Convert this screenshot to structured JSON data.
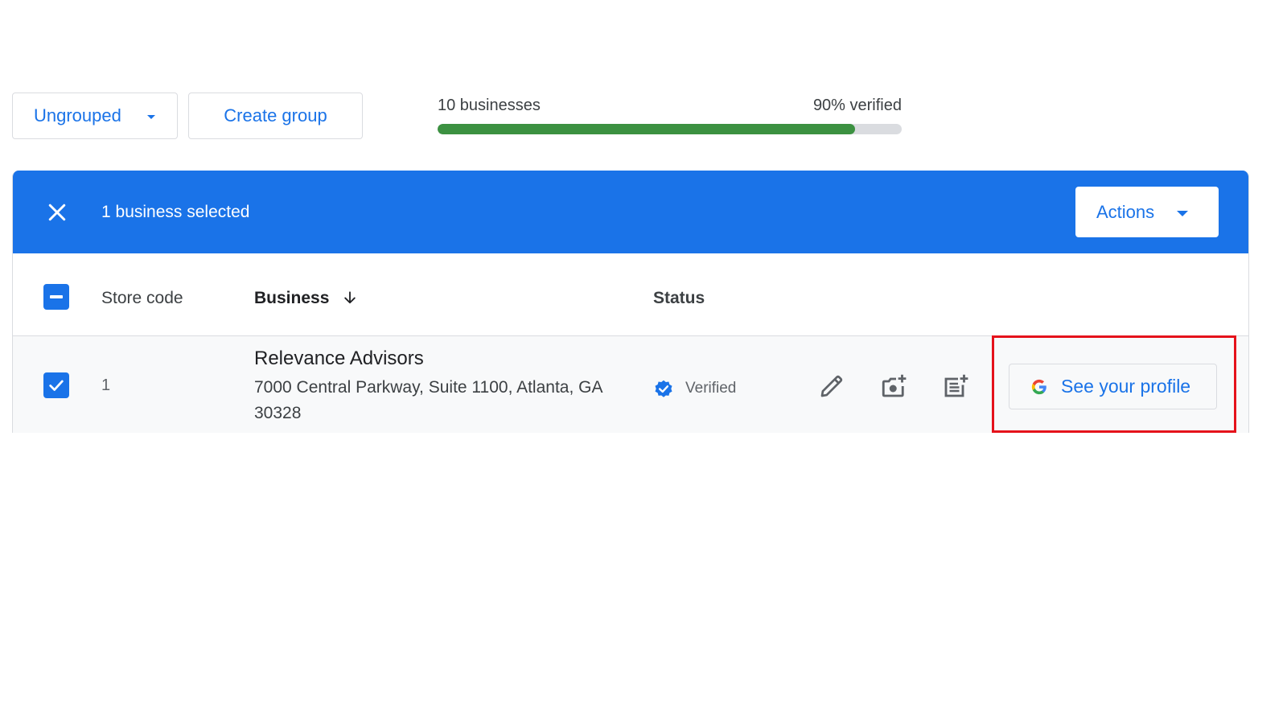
{
  "toolbar": {
    "group_select": {
      "value": "Ungrouped",
      "icon": "caret-down-icon"
    },
    "create_group_label": "Create group"
  },
  "summary": {
    "businesses_label": "10 businesses",
    "verified_label": "90% verified",
    "verified_fraction": 0.9
  },
  "selection_bar": {
    "close_icon": "close-icon",
    "selected_text": "1 business selected",
    "actions_label": "Actions"
  },
  "table": {
    "columns": [
      {
        "label": "Store code"
      },
      {
        "label": "Business",
        "sort": "descending",
        "sort_icon": "arrow-down-icon"
      },
      {
        "label": "Status"
      }
    ],
    "header_checkbox_state": "indeterminate",
    "rows": [
      {
        "checked": true,
        "store_code": "1",
        "business_name": "Relevance Advisors",
        "address": "7000 Central Parkway, Suite 1100, Atlanta, GA 30328",
        "status": "Verified",
        "status_icon": "verified-badge-icon",
        "row_actions": [
          "edit-icon",
          "add-photo-icon",
          "add-post-icon"
        ],
        "profile_button_label": "See your profile"
      }
    ]
  },
  "colors": {
    "accent": "#1a73e8",
    "progress": "#3c9141",
    "highlight": "#e5121b"
  }
}
